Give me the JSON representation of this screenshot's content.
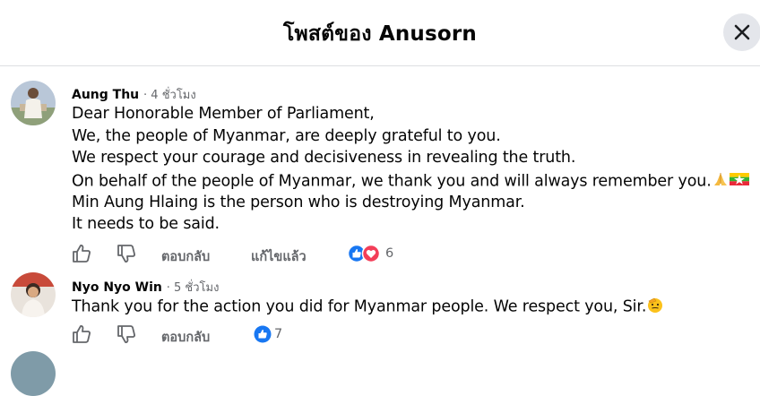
{
  "header": {
    "title": "โพสต์ของ Anusorn"
  },
  "comments": [
    {
      "author": "Aung Thu",
      "time": "· 4 ชั่วโมง",
      "lines": [
        "Dear Honorable Member of Parliament,",
        "We, the people of Myanmar, are deeply grateful to you.",
        "We respect your courage and decisiveness in revealing the truth.",
        "On behalf of the people of Myanmar, we thank you and will always remember you.",
        "Min Aung Hlaing is the person who is destroying Myanmar.",
        "It needs to be said."
      ],
      "reply_label": "ตอบกลับ",
      "edited_label": "แก้ไขแล้ว",
      "reaction_count": "6"
    },
    {
      "author": "Nyo Nyo Win",
      "time": "· 5 ชั่วโมง",
      "lines": [
        "Thank you for the action you did for Myanmar people. We respect you, Sir."
      ],
      "reply_label": "ตอบกลับ",
      "reaction_count": "7"
    }
  ],
  "icons": {
    "close": "close-icon",
    "like": "thumbs-up-outline-icon",
    "dislike": "thumbs-down-outline-icon",
    "like_reaction": "like-reaction-icon",
    "love_reaction": "love-reaction-icon",
    "pray_emoji": "folded-hands-emoji",
    "flag_emoji": "myanmar-flag-emoji",
    "salute_emoji": "saluting-face-emoji"
  },
  "colors": {
    "like_blue": "#1877f2",
    "love_red": "#f33e58",
    "secondary_text": "#65676b"
  }
}
